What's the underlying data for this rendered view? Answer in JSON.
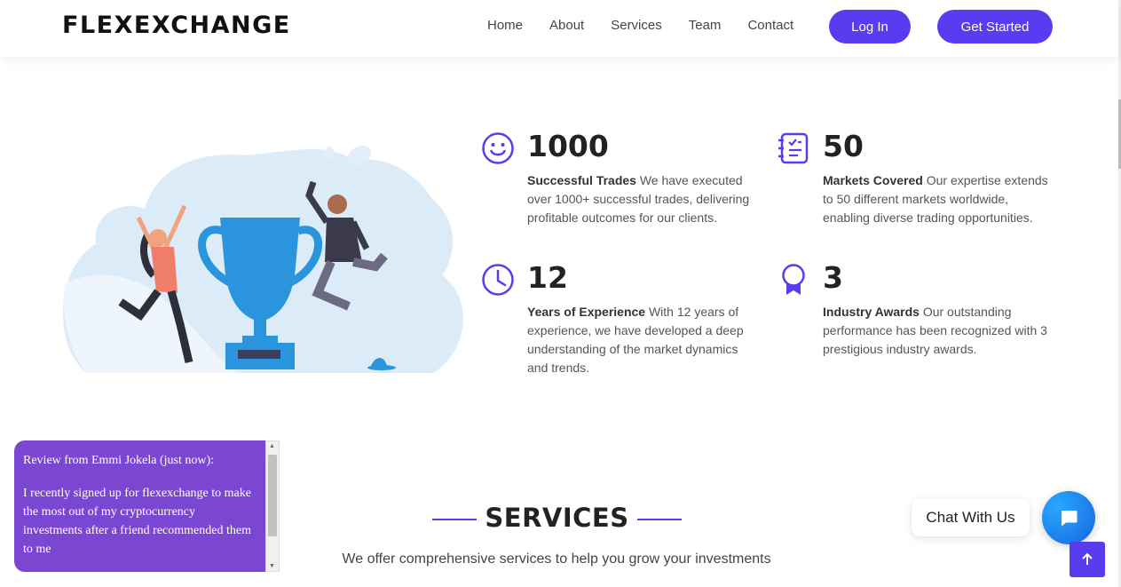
{
  "header": {
    "logo": "FLEXEXCHANGE",
    "nav": [
      "Home",
      "About",
      "Services",
      "Team",
      "Contact"
    ],
    "login": "Log In",
    "get_started": "Get Started"
  },
  "stats": [
    {
      "number": "1000",
      "title": "Successful Trades",
      "text": "We have executed over 1000+ successful trades, delivering profitable outcomes for our clients.",
      "icon": "smiley-icon"
    },
    {
      "number": "50",
      "title": "Markets Covered",
      "text": "Our expertise extends to 50 different markets worldwide, enabling diverse trading opportunities.",
      "icon": "journal-icon"
    },
    {
      "number": "12",
      "title": "Years of Experience",
      "text": "With 12 years of experience, we have developed a deep understanding of the market dynamics and trends.",
      "icon": "clock-icon"
    },
    {
      "number": "3",
      "title": "Industry Awards",
      "text": "Our outstanding performance has been recognized with 3 prestigious industry awards.",
      "icon": "award-icon"
    }
  ],
  "services": {
    "title": "SERVICES",
    "subtitle": "We offer comprehensive services to help you grow your investments"
  },
  "review": {
    "header": "Review from Emmi Jokela (just now):",
    "body": "I recently signed up for flexexchange to make the most out of my cryptocurrency investments after a friend recommended them to me"
  },
  "chat": {
    "label": "Chat With Us"
  },
  "colors": {
    "accent": "#5a3cf0",
    "review_bg": "#7b46d1",
    "chat_blue": "#1e88f0"
  }
}
